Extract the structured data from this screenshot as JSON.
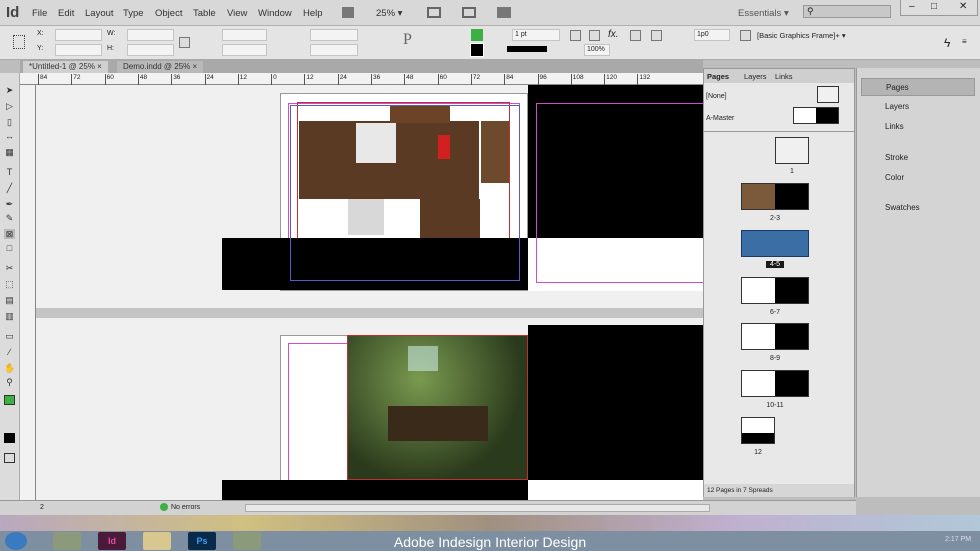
{
  "app": {
    "logo": "Id",
    "menus": [
      "File",
      "Edit",
      "Layout",
      "Type",
      "Object",
      "Table",
      "View",
      "Window",
      "Help"
    ],
    "zoom": "25%",
    "workspace": "Essentials",
    "search_placeholder": ""
  },
  "control": {
    "x_label": "X:",
    "y_label": "Y:",
    "w_label": "W:",
    "h_label": "H:",
    "stroke_weight": "1 pt",
    "opacity": "100%",
    "offset": "1p0",
    "object_style": "[Basic Graphics Frame]+"
  },
  "tabs": [
    {
      "label": "*Untitled-1 @ 25%",
      "active": true
    },
    {
      "label": "Demo.indd @ 25%",
      "active": false
    }
  ],
  "ruler": [
    "84",
    "72",
    "60",
    "48",
    "36",
    "24",
    "12",
    "0",
    "12",
    "24",
    "36",
    "48",
    "60",
    "72",
    "84",
    "96",
    "108",
    "120",
    "132"
  ],
  "pages_panel": {
    "tabs": [
      "Pages",
      "Layers",
      "Links"
    ],
    "masters": [
      "[None]",
      "A-Master"
    ],
    "pages": [
      "1",
      "2-3",
      "4-5",
      "6-7",
      "8-9",
      "10-11",
      "12"
    ],
    "selected": "4-5",
    "footer": "12 Pages in 7 Spreads"
  },
  "right_panel": {
    "items": [
      "Pages",
      "Layers",
      "Links",
      "Stroke",
      "Color",
      "Swatches"
    ]
  },
  "status": {
    "page": "2",
    "errors": "No errors"
  },
  "taskbar": {
    "caption": "Adobe Indesign Interior Design",
    "time": "2:17 PM",
    "apps": [
      "Id",
      "Ps"
    ]
  },
  "colors": {
    "margin": "#d04fc8",
    "selection": "#3a6ea5",
    "accent_green": "#3cb043"
  }
}
